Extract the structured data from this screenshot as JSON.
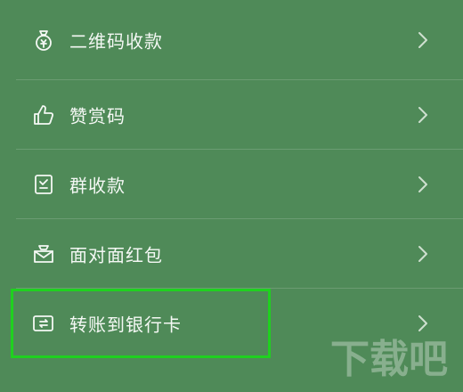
{
  "menu": {
    "items": [
      {
        "label": "二维码收款",
        "icon": "qr-money-bag-icon"
      },
      {
        "label": "赞赏码",
        "icon": "thumbs-up-icon"
      },
      {
        "label": "群收款",
        "icon": "group-bill-icon"
      },
      {
        "label": "面对面红包",
        "icon": "red-packet-icon"
      },
      {
        "label": "转账到银行卡",
        "icon": "bank-card-transfer-icon"
      }
    ]
  },
  "highlight": {
    "item": "转账到银行卡",
    "color": "#1fd11f"
  },
  "colors": {
    "background": "#4f8a58",
    "text": "#f4f8f4"
  },
  "watermark": {
    "text": "下载吧"
  }
}
